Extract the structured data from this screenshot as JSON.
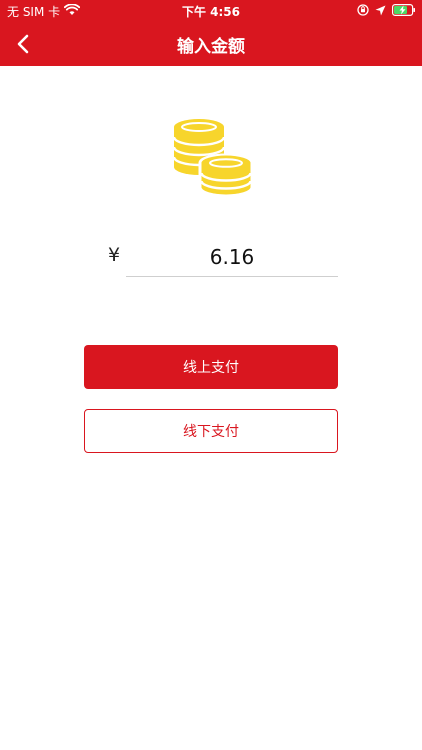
{
  "status_bar": {
    "carrier": "无 SIM 卡",
    "time": "下午 4:56"
  },
  "nav": {
    "title": "输入金额"
  },
  "icons": {
    "back": "chevron-left-icon",
    "coins": "coins-icon",
    "wifi": "wifi-icon",
    "location": "location-arrow-icon",
    "lock": "orientation-lock-icon",
    "battery": "battery-charging-icon"
  },
  "amount": {
    "currency_symbol": "¥",
    "value": "6.16"
  },
  "buttons": {
    "online_pay": "线上支付",
    "offline_pay": "线下支付"
  },
  "colors": {
    "primary": "#d9161f",
    "coins": "#f7d52c"
  }
}
